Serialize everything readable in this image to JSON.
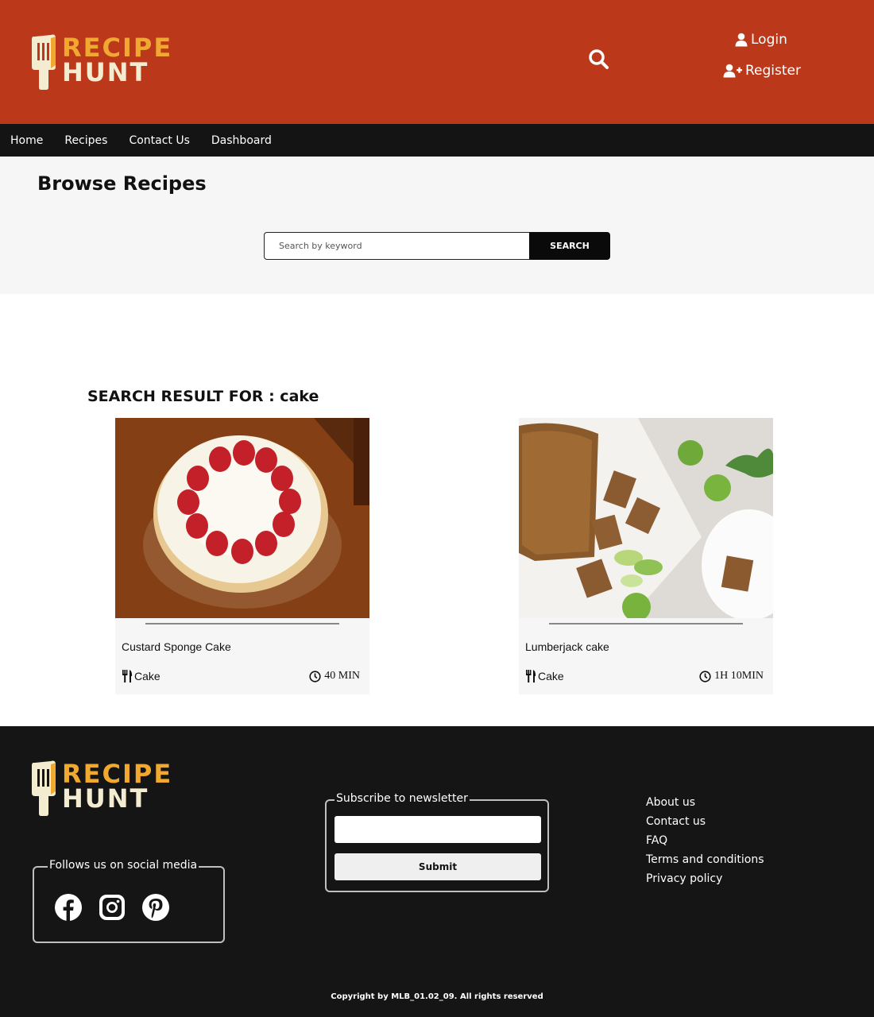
{
  "brand": {
    "line1": "RECIPE",
    "line2": "HUNT"
  },
  "header": {
    "login_label": "Login",
    "register_label": "Register"
  },
  "nav": {
    "items": [
      "Home",
      "Recipes",
      "Contact Us",
      "Dashboard"
    ]
  },
  "browse": {
    "title": "Browse Recipes",
    "search_placeholder": "Search by keyword",
    "search_button": "SEARCH"
  },
  "results": {
    "heading": "SEARCH RESULT FOR : cake",
    "cards": [
      {
        "title": "Custard Sponge Cake",
        "category": "Cake",
        "time": "40 MIN"
      },
      {
        "title": "Lumberjack cake",
        "category": "Cake",
        "time": "1H 10MIN"
      }
    ]
  },
  "footer": {
    "social_legend": "Follows us on social media",
    "social_icons": [
      "facebook-icon",
      "instagram-icon",
      "pinterest-icon"
    ],
    "newsletter_legend": "Subscribe to newsletter",
    "newsletter_value": "",
    "submit_label": "Submit",
    "links": [
      "About us",
      "Contact us",
      "FAQ",
      "Terms and conditions",
      "Privacy policy"
    ],
    "copyright": "Copyright by MLB_01.02_09. All rights reserved"
  },
  "colors": {
    "header_bg": "#bb381b",
    "nav_bg": "#141414",
    "footer_bg": "#151515",
    "logo_accent": "#f0a830",
    "logo_cream": "#f4ecd0"
  }
}
